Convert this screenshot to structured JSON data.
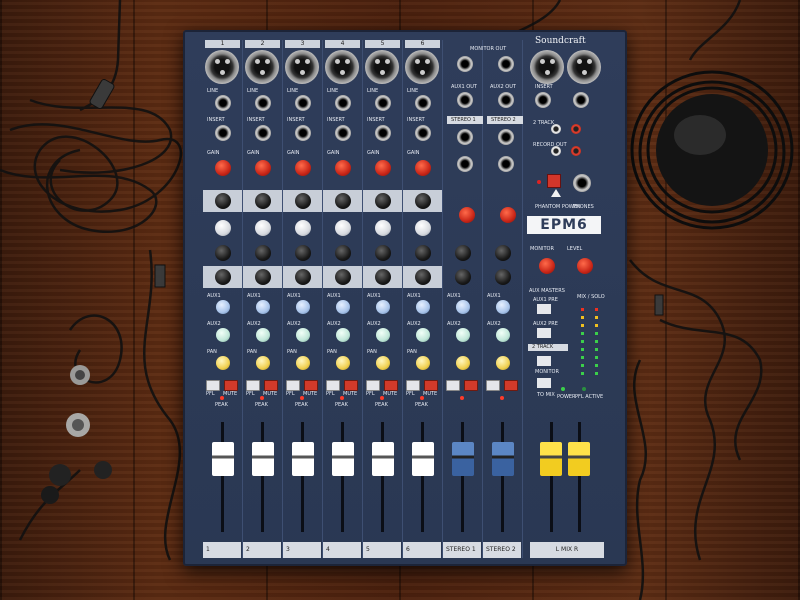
{
  "brand": "Soundcraft",
  "model": "EPM6",
  "mono_channels": [
    {
      "number": "1",
      "line": "LINE",
      "insert": "INSERT",
      "gain": "GAIN",
      "pfl": "PFL",
      "mute": "MUTE",
      "peak": "PEAK",
      "strip_label": "1"
    },
    {
      "number": "2",
      "line": "LINE",
      "insert": "INSERT",
      "gain": "GAIN",
      "pfl": "PFL",
      "mute": "MUTE",
      "peak": "PEAK",
      "strip_label": "2"
    },
    {
      "number": "3",
      "line": "LINE",
      "insert": "INSERT",
      "gain": "GAIN",
      "pfl": "PFL",
      "mute": "MUTE",
      "peak": "PEAK",
      "strip_label": "3"
    },
    {
      "number": "4",
      "line": "LINE",
      "insert": "INSERT",
      "gain": "GAIN",
      "pfl": "PFL",
      "mute": "MUTE",
      "peak": "PEAK",
      "strip_label": "4"
    },
    {
      "number": "5",
      "line": "LINE",
      "insert": "INSERT",
      "gain": "GAIN",
      "pfl": "PFL",
      "mute": "MUTE",
      "peak": "PEAK",
      "strip_label": "5"
    },
    {
      "number": "6",
      "line": "LINE",
      "insert": "INSERT",
      "gain": "GAIN",
      "pfl": "PFL",
      "mute": "MUTE",
      "peak": "PEAK",
      "strip_label": "6"
    }
  ],
  "aux_labels": [
    "AUX1",
    "AUX2",
    "PAN"
  ],
  "stereo_section": {
    "monitor_out": "MONITOR OUT",
    "aux1_out": "AUX1 OUT",
    "aux2_out": "AUX2 OUT",
    "stereo1": "STEREO 1",
    "stereo2": "STEREO 2",
    "strip_labels": [
      "STEREO 1",
      "STEREO 2"
    ]
  },
  "master_section": {
    "mix_outputs": [
      "MIX L",
      "MIX R"
    ],
    "insert": "INSERT",
    "two_track": "2 TRACK",
    "record_out": "RECORD OUT",
    "phantom_power": "PHANTOM POWER",
    "phones": "PHONES",
    "monitor": "MONITOR",
    "level": "LEVEL",
    "aux_masters": "AUX MASTERS",
    "aux1_pre": "AUX1 PRE",
    "aux2_pre": "AUX2 PRE",
    "two_track_btn": "2 TRACK",
    "monitor_btn": "MONITOR",
    "to_mix": "TO MIX",
    "power": "POWER",
    "pfl_active": "PFL ACTIVE",
    "meter_header": "MIX / SOLO",
    "mix_label": "L     MIX     R"
  },
  "colors": {
    "panel": "#2d3a57",
    "gain_knob": "#d83a24",
    "stereo_fader": "#4a74b4",
    "master_fader": "#f2d030",
    "channel_fader": "#ffffff"
  }
}
